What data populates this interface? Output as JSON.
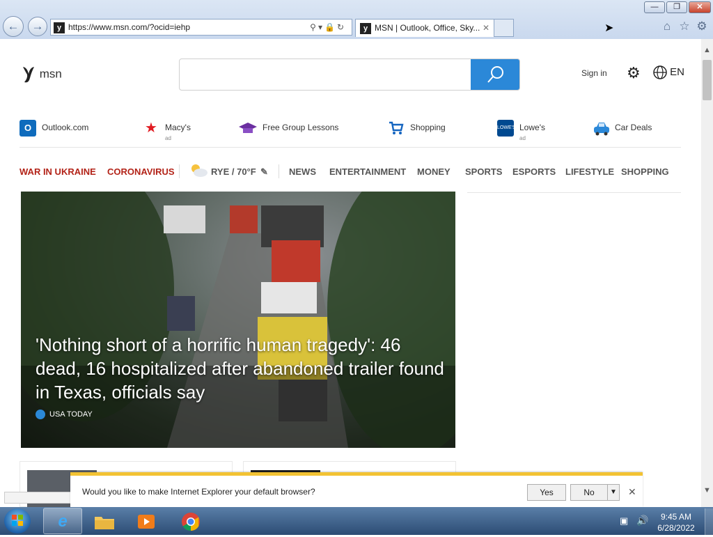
{
  "browser": {
    "address": "https://www.msn.com/?ocid=iehp",
    "tab_title": "MSN | Outlook, Office, Sky...",
    "window_buttons": [
      "—",
      "❐",
      "✕"
    ]
  },
  "header": {
    "logo_text": "msn",
    "search_placeholder": "",
    "signin": "Sign in",
    "language": "EN"
  },
  "quick_links": [
    {
      "label": "Outlook.com",
      "ad": "",
      "color": "#0f6cbd"
    },
    {
      "label": "Macy's",
      "ad": "ad",
      "color": "#e11b22"
    },
    {
      "label": "Free Group Lessons",
      "ad": "",
      "color": "#6b2fa0"
    },
    {
      "label": "Shopping",
      "ad": "",
      "color": "#1565c0"
    },
    {
      "label": "Lowe's",
      "ad": "ad",
      "color": "#004990"
    },
    {
      "label": "Car Deals",
      "ad": "",
      "color": "#2b88d8"
    }
  ],
  "nav": {
    "highlight": [
      "WAR IN UKRAINE",
      "CORONAVIRUS"
    ],
    "weather": "RYE / 70°F",
    "categories": [
      "NEWS",
      "ENTERTAINMENT",
      "MONEY",
      "SPORTS",
      "ESPORTS",
      "LIFESTYLE",
      "SHOPPING"
    ]
  },
  "hero": {
    "headline": "'Nothing short of a horrific human tragedy': 46 dead, 16 hospitalized after abandoned trailer found in Texas, officials say",
    "source": "USA TODAY"
  },
  "notification": {
    "text": "Would you like to make Internet Explorer your default browser?",
    "yes": "Yes",
    "no": "No"
  },
  "taskbar": {
    "time": "9:45 AM",
    "date": "6/28/2022"
  },
  "colors": {
    "accent": "#2b88d8",
    "nav_highlight": "#b32318",
    "notify_bar": "#f2c233"
  }
}
